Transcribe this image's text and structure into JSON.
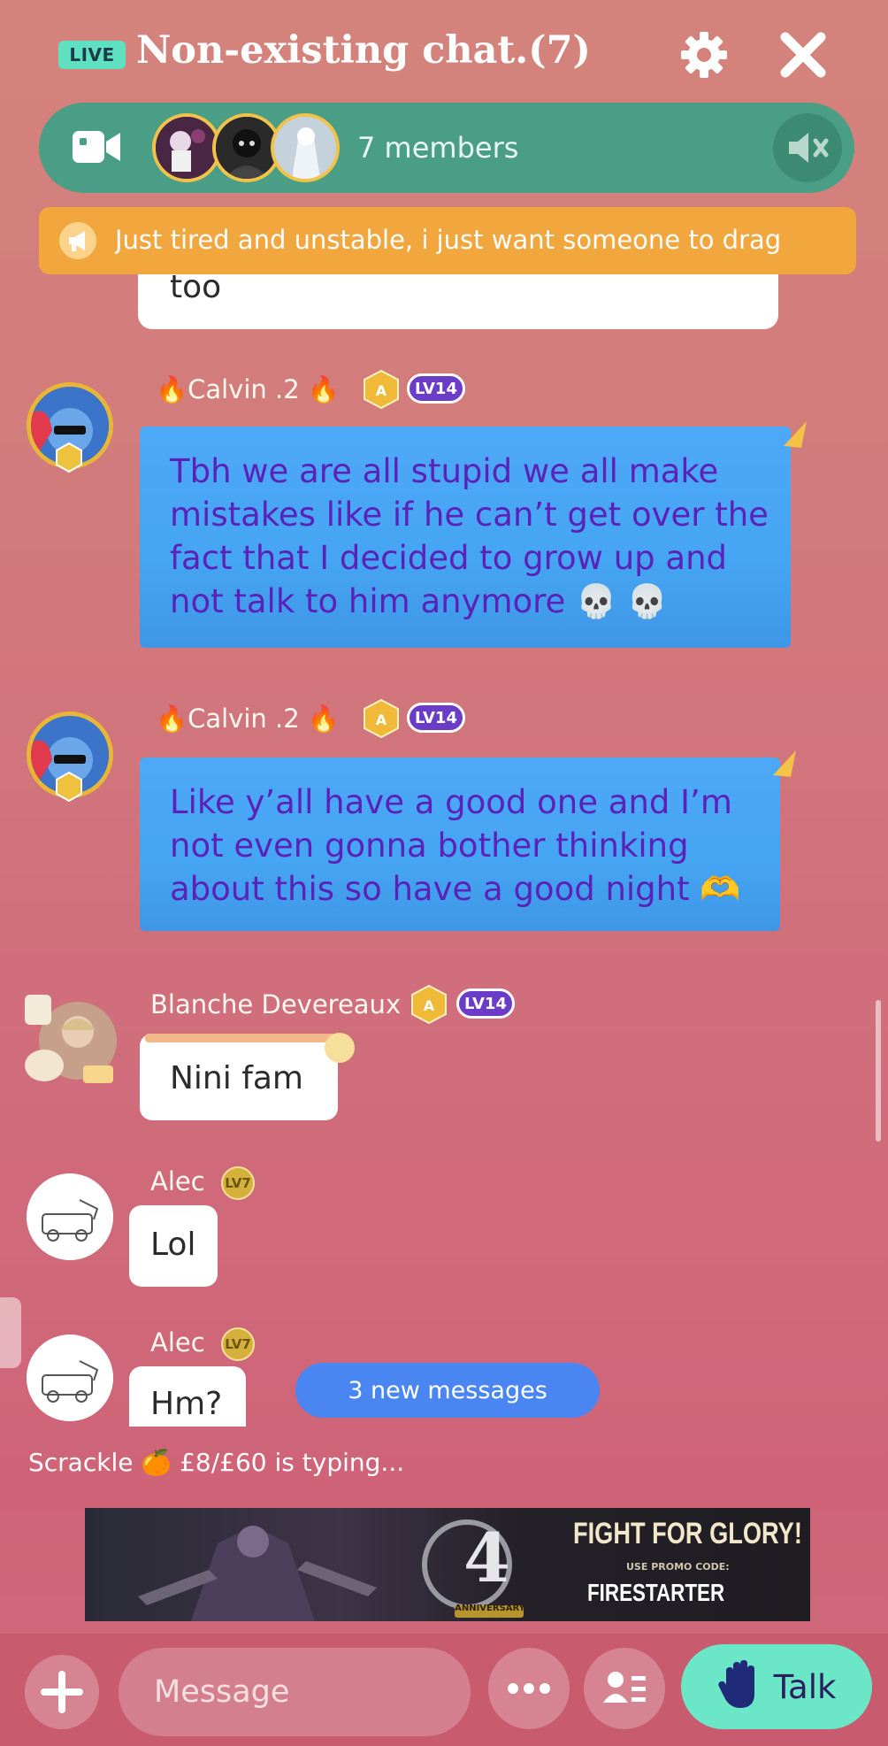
{
  "header": {
    "live_label": "LIVE",
    "title": "Non-existing chat.(7)",
    "settings_icon": "gear-icon",
    "close_icon": "close-icon"
  },
  "members_bar": {
    "video_icon": "video-camera-icon",
    "members_label": "7 members",
    "mute_icon": "speaker-muted-icon"
  },
  "announcement": {
    "icon": "megaphone-icon",
    "text": "Just tired and unstable, i just want someone to drag"
  },
  "messages": [
    {
      "text": "too"
    },
    {
      "username": "Calvin .2",
      "level": "LV14",
      "text_lines": [
        "Tbh we are all stupid we all make",
        "mistakes like if he can’t get over the",
        "fact that I decided to grow up and",
        "not talk to him anymore 💀 💀"
      ]
    },
    {
      "username": "Calvin .2",
      "level": "LV14",
      "text_lines": [
        "Like y’all have a good one and I’m",
        "not even gonna bother thinking",
        "about this so have a good night 🫶"
      ]
    },
    {
      "username": "Blanche Devereaux",
      "level": "LV14",
      "text": "Nini fam"
    },
    {
      "username": "Alec",
      "level": "LV7",
      "text": "Lol"
    },
    {
      "username": "Alec",
      "level": "LV7",
      "text": "Hm?"
    }
  ],
  "new_messages_label": "3 new messages",
  "typing_indicator": "Scrackle 🍊 £8/£60 is typing...",
  "banner": {
    "headline": "FIGHT FOR GLORY!",
    "promo_label": "USE PROMO CODE:",
    "promo_code": "FIRESTARTER",
    "anniversary_number": "4",
    "anniversary_label": "ANNIVERSARY"
  },
  "composer": {
    "placeholder": "Message",
    "talk_label": "Talk"
  },
  "colors": {
    "accent_teal": "#6be6c6",
    "members_bar": "#4a9e86",
    "announcement": "#f2a63e",
    "bubble_blue": "#45a5f3",
    "bubble_text": "#5a22b8"
  }
}
